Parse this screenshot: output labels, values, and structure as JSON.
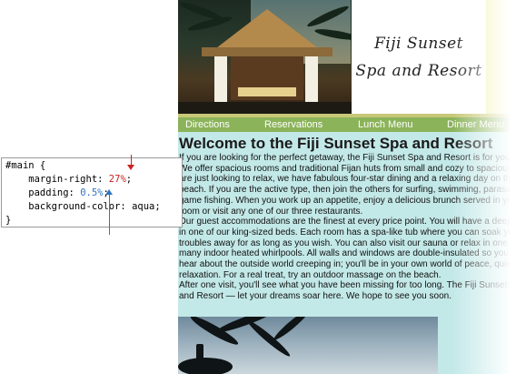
{
  "header": {
    "title_line1": "Fiji Sunset",
    "title_line2": "Spa and Resort"
  },
  "nav": {
    "items": [
      "Directions",
      "Reservations",
      "Lunch Menu",
      "Dinner Menu"
    ]
  },
  "main": {
    "heading": "Welcome to the Fiji Sunset Spa and Resort",
    "paragraph": "If you are looking for the perfect getaway, the Fiji Sunset Spa and Resort is for you.\nWe offer spacious rooms and traditional Fijan huts from small and cozy to spacious. If you are just looking to relax, we have fabulous four-star dining and a relaxing day on the beach. If you are the active type, then join the others for surfing, swimming, parasailing, or game fishing. When you work up an appetite, enjoy a delicious brunch served in your room or visit any one of our three restaurants.\nOur guest accommodations are the finest at every price point. You will have a deep sleep in one of our king-sized beds. Each room has a spa-like tub where you can soak your troubles away for as long as you wish. You can also visit our sauna or relax in one of our many indoor heated whirlpools. All walls and windows are double-insulated so you won't hear about the outside world creeping in; you'll be in your own world of peace, quiet, and relaxation. For a real treat, try an outdoor massage on the beach.\nAfter one visit, you'll see what you have been missing for too long. The Fiji Sunset Spa and Resort — let your dreams soar here. We hope to see you soon."
  },
  "code": {
    "line1": "#main {",
    "line2_prop": "    margin-right: ",
    "line2_val": "27%",
    "line2_end": ";",
    "line3_prop": "    padding: ",
    "line3_val": "0.5%",
    "line3_end": ";",
    "line4": "    background-color: aqua;",
    "line5": "}"
  },
  "colors": {
    "nav_bg": "#8bb35a",
    "main_bg": "#c3e8e8",
    "highlight_red": "#cc2222",
    "highlight_blue": "#2f74c0"
  }
}
